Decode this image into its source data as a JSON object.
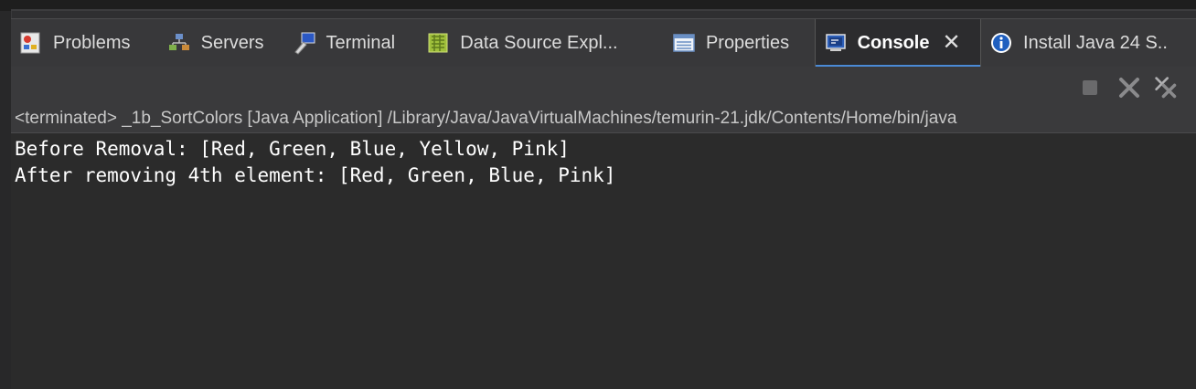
{
  "tabs": [
    {
      "label": "Problems",
      "icon": "problems-icon",
      "active": false
    },
    {
      "label": "Servers",
      "icon": "servers-icon",
      "active": false
    },
    {
      "label": "Terminal",
      "icon": "terminal-icon",
      "active": false
    },
    {
      "label": "Data Source Expl...",
      "icon": "data-source-icon",
      "active": false
    },
    {
      "label": "Properties",
      "icon": "properties-icon",
      "active": false
    },
    {
      "label": "Console",
      "icon": "console-icon",
      "active": true
    },
    {
      "label": "Install Java 24 S..",
      "icon": "info-icon",
      "active": false
    }
  ],
  "toolbar": {
    "terminate_icon": "stop-icon",
    "remove_icon": "remove-launch-icon",
    "remove_all_icon": "remove-all-icon"
  },
  "status": {
    "text": "<terminated> _1b_SortColors [Java Application] /Library/Java/JavaVirtualMachines/temurin-21.jdk/Contents/Home/bin/java"
  },
  "console": {
    "lines": [
      "Before Removal: [Red, Green, Blue, Yellow, Pink]",
      "After removing 4th element: [Red, Green, Blue, Pink]"
    ]
  },
  "colors": {
    "active_tab_underline": "#4a8ad6",
    "console_background": "#2b2b2b",
    "console_text": "#ffffff"
  }
}
